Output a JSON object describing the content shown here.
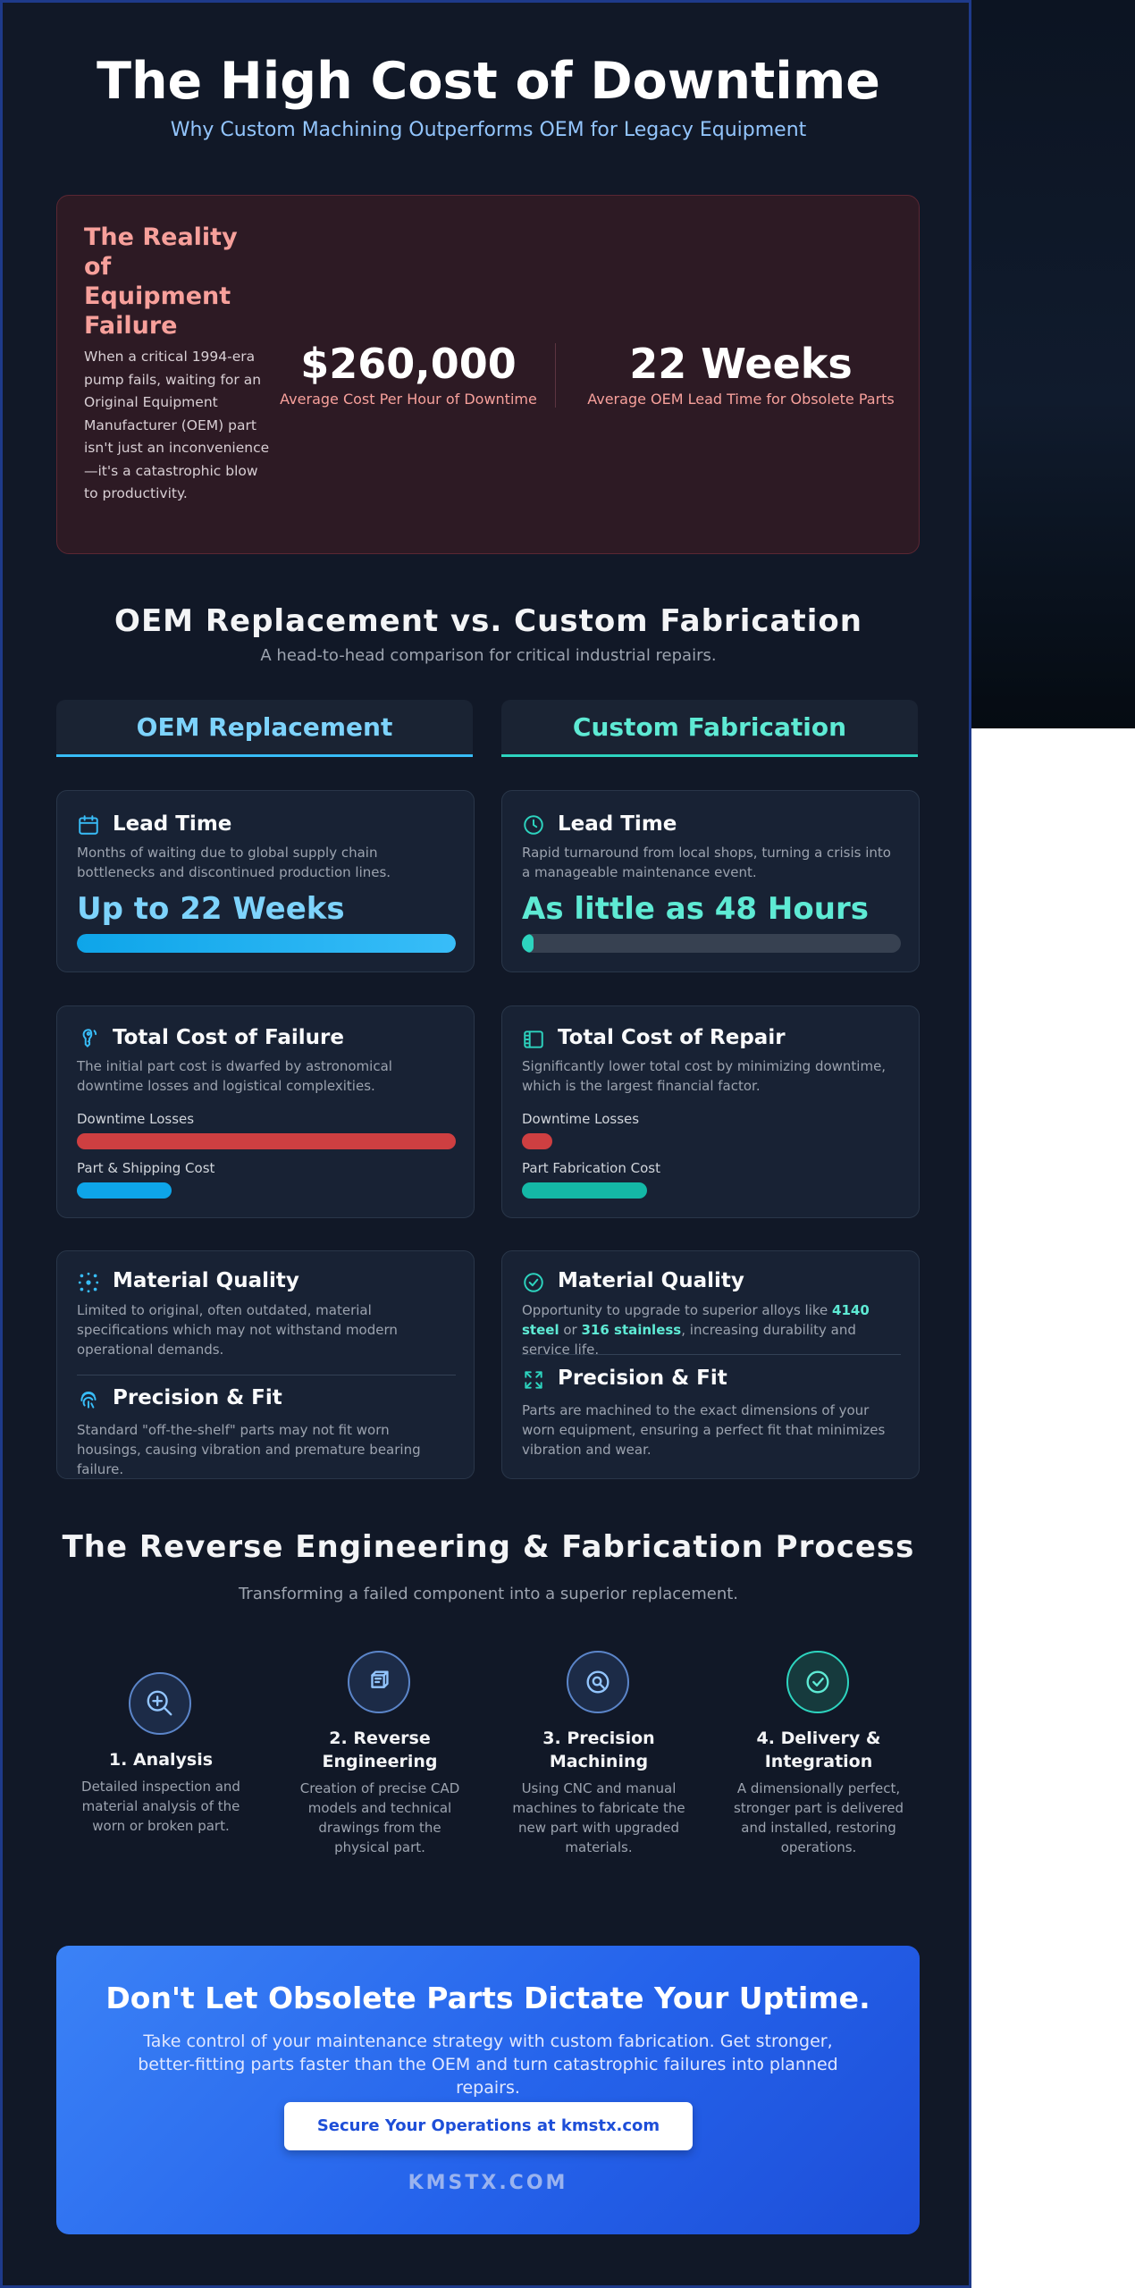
{
  "header": {
    "title": "The High Cost of Downtime",
    "subtitle": "Why Custom Machining Outperforms OEM for Legacy Equipment"
  },
  "reality": {
    "title": "The Reality of Equipment Failure",
    "text": "When a critical 1994-era pump fails, waiting for an Original Equipment Manufacturer (OEM) part isn't just an inconvenience—it's a catastrophic blow to productivity.",
    "stats": [
      {
        "value": "$260,000",
        "label": "Average Cost Per Hour of Downtime"
      },
      {
        "value": "22 Weeks",
        "label": "Average OEM Lead Time for Obsolete Parts"
      }
    ]
  },
  "comparison": {
    "title": "OEM Replacement vs. Custom Fabrication",
    "subtitle": "A head-to-head comparison for critical industrial repairs.",
    "oem_heading": "OEM Replacement",
    "custom_heading": "Custom Fabrication",
    "oem": {
      "lead_time": {
        "title": "Lead Time",
        "desc": "Months of waiting due to global supply chain bottlenecks and discontinued production lines.",
        "value": "Up to 22 Weeks",
        "bar_fraction": 1.0
      },
      "cost": {
        "title": "Total Cost of Failure",
        "desc": "The initial part cost is dwarfed by astronomical downtime losses and logistical complexities.",
        "bars": [
          {
            "label": "Downtime Losses",
            "fraction": 1.0
          },
          {
            "label": "Part & Shipping Cost",
            "fraction": 0.25
          }
        ]
      },
      "material": {
        "title": "Material Quality",
        "desc": "Limited to original, often outdated, material specifications which may not withstand modern operational demands."
      },
      "precision": {
        "title": "Precision & Fit",
        "desc": "Standard \"off-the-shelf\" parts may not fit worn housings, causing vibration and premature bearing failure."
      }
    },
    "custom": {
      "lead_time": {
        "title": "Lead Time",
        "desc": "Rapid turnaround from local shops, turning a crisis into a manageable maintenance event.",
        "value": "As little as 48 Hours",
        "bar_fraction": 0.03
      },
      "cost": {
        "title": "Total Cost of Repair",
        "desc": "Significantly lower total cost by minimizing downtime, which is the largest financial factor.",
        "bars": [
          {
            "label": "Downtime Losses",
            "fraction": 0.08
          },
          {
            "label": "Part Fabrication Cost",
            "fraction": 0.33
          }
        ]
      },
      "material": {
        "title": "Material Quality",
        "desc_before": "Opportunity to upgrade to superior alloys like ",
        "highlight_1": "4140 steel",
        "desc_mid": " or ",
        "highlight_2": "316 stainless",
        "desc_after": ", increasing durability and service life."
      },
      "precision": {
        "title": "Precision & Fit",
        "desc": "Parts are machined to the exact dimensions of your worn equipment, ensuring a perfect fit that minimizes vibration and wear."
      }
    }
  },
  "process": {
    "title": "The Reverse Engineering & Fabrication Process",
    "subtitle": "Transforming a failed component into a superior replacement.",
    "steps": [
      {
        "title": "1. Analysis",
        "desc": "Detailed inspection and material analysis of the worn or broken part."
      },
      {
        "title": "2. Reverse Engineering",
        "desc": "Creation of precise CAD models and technical drawings from the physical part."
      },
      {
        "title": "3. Precision Machining",
        "desc": "Using CNC and manual machines to fabricate the new part with upgraded materials."
      },
      {
        "title": "4. Delivery & Integration",
        "desc": "A dimensionally perfect, stronger part is delivered and installed, restoring operations."
      }
    ]
  },
  "cta": {
    "title": "Don't Let Obsolete Parts Dictate Your Uptime.",
    "text": "Take control of your maintenance strategy with custom fabrication. Get stronger, better-fitting parts faster than the OEM and turn catastrophic failures into planned repairs.",
    "button_label": "Secure Your Operations at kmstx.com",
    "brand": "KMSTX.COM"
  },
  "colors": {
    "background": "#111827",
    "card": "#182234",
    "oem_accent": "#38bdf8",
    "custom_accent": "#2dd4bf",
    "alert_red": "#ef4444",
    "cta_blue": "#2563eb"
  }
}
